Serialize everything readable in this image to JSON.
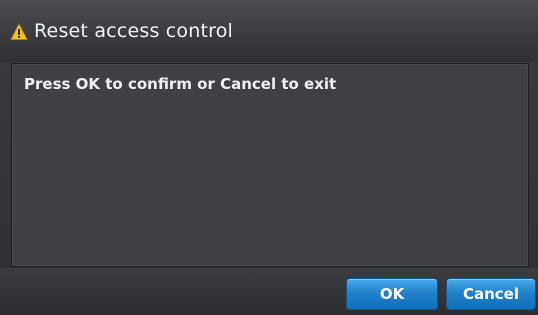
{
  "dialog": {
    "title": "Reset access control",
    "title_icon": "warning-icon",
    "message": "Press OK to confirm or Cancel to exit",
    "buttons": {
      "ok_label": "OK",
      "cancel_label": "Cancel"
    }
  },
  "colors": {
    "accent": "#1e7fc8",
    "warning": "#f2c21a",
    "background": "#3e4043",
    "text": "#f0f0f0"
  }
}
